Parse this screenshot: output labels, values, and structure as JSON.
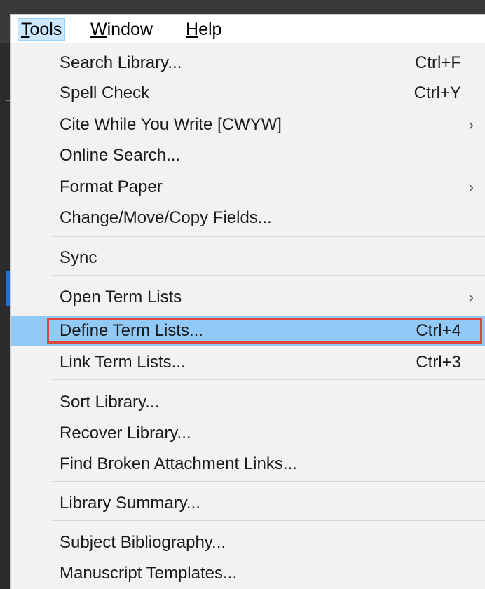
{
  "menubar": {
    "tools": {
      "prefix": "",
      "accel": "T",
      "rest": "ools"
    },
    "window": {
      "prefix": "",
      "accel": "W",
      "rest": "indow"
    },
    "help": {
      "prefix": "",
      "accel": "H",
      "rest": "elp"
    }
  },
  "menu": {
    "items": [
      {
        "label": "Search Library...",
        "shortcut": "Ctrl+F"
      },
      {
        "label": "Spell Check",
        "shortcut": "Ctrl+Y"
      },
      {
        "label": "Cite While You Write [CWYW]",
        "arrow": "›"
      },
      {
        "label": "Online Search..."
      },
      {
        "label": "Format Paper",
        "arrow": "›"
      },
      {
        "label": "Change/Move/Copy Fields..."
      },
      {
        "label": "Sync"
      },
      {
        "label": "Open Term Lists",
        "arrow": "›"
      },
      {
        "label": "Define Term Lists...",
        "shortcut": "Ctrl+4"
      },
      {
        "label": "Link Term Lists...",
        "shortcut": "Ctrl+3"
      },
      {
        "label": "Sort Library..."
      },
      {
        "label": "Recover Library..."
      },
      {
        "label": "Find Broken Attachment Links..."
      },
      {
        "label": "Library Summary..."
      },
      {
        "label": "Subject Bibliography..."
      },
      {
        "label": "Manuscript Templates..."
      }
    ]
  },
  "colors": {
    "highlight": "#91c9f7",
    "annotation_box": "#e0443a",
    "menu_background": "#f2f2f2"
  }
}
